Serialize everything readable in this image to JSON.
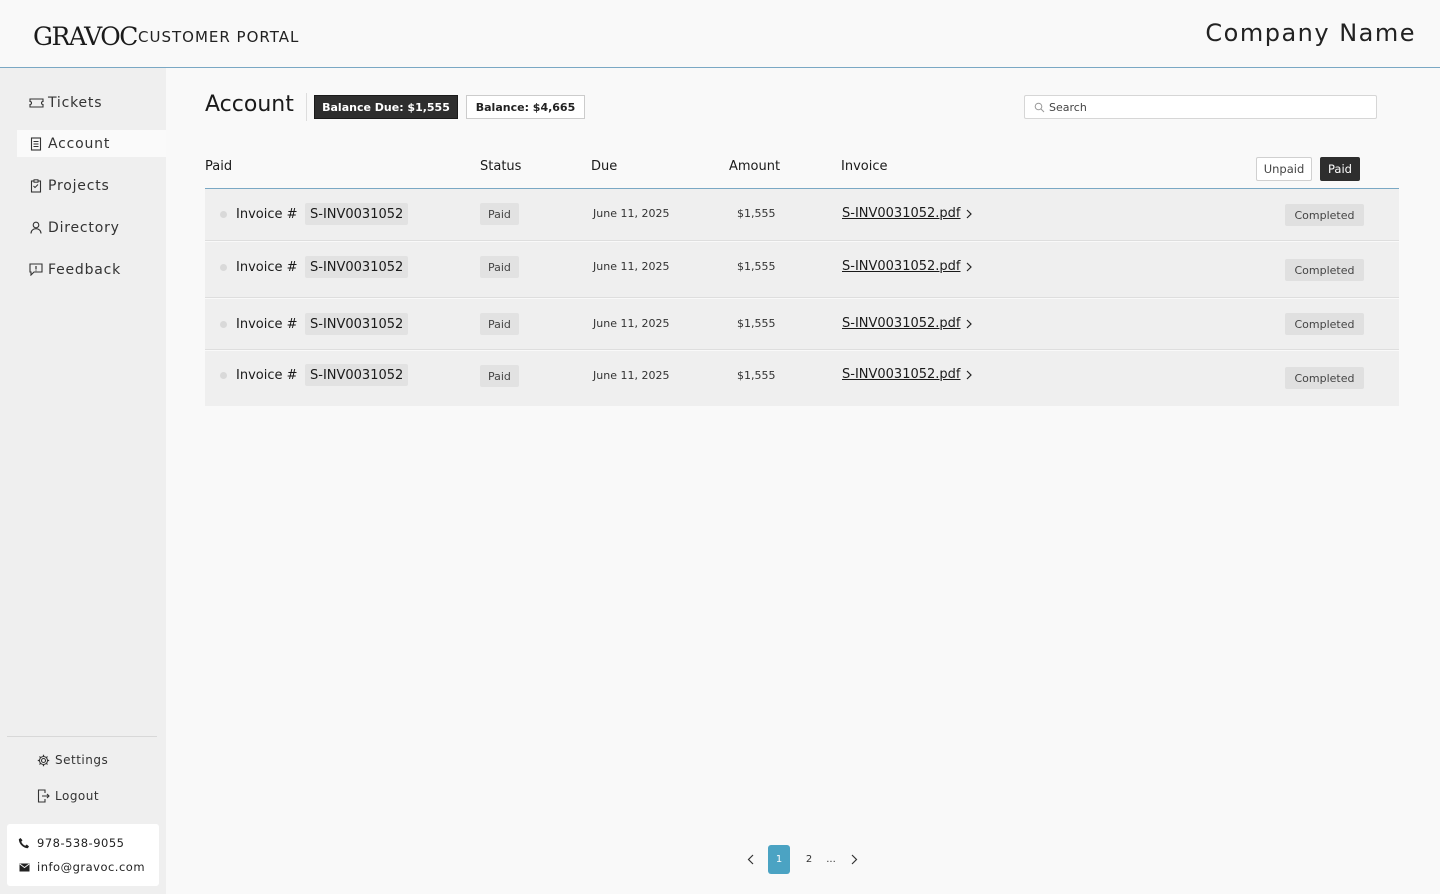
{
  "header": {
    "logo": "GRAVOC",
    "portal_title": "CUSTOMER PORTAL",
    "company_name": "Company Name"
  },
  "sidebar": {
    "items": [
      {
        "label": "Tickets",
        "icon": "ticket-icon",
        "active": false
      },
      {
        "label": "Account",
        "icon": "document-icon",
        "active": true
      },
      {
        "label": "Projects",
        "icon": "clipboard-icon",
        "active": false
      },
      {
        "label": "Directory",
        "icon": "person-icon",
        "active": false
      },
      {
        "label": "Feedback",
        "icon": "feedback-icon",
        "active": false
      }
    ],
    "settings_label": "Settings",
    "logout_label": "Logout",
    "phone": "978-538-9055",
    "email": "info@gravoc.com"
  },
  "main": {
    "title": "Account",
    "balance_due": "Balance Due: $1,555",
    "balance": "Balance: $4,665",
    "search_placeholder": "Search",
    "columns": [
      "Paid",
      "Status",
      "Due",
      "Amount",
      "Invoice"
    ],
    "filters": {
      "unpaid": "Unpaid",
      "paid": "Paid",
      "selected": "Paid"
    },
    "rows": [
      {
        "label": "Invoice #",
        "number": "S-INV0031052",
        "status": "Paid",
        "due": "June 11, 2025",
        "amount": "$1,555",
        "file": "S-INV0031052.pdf",
        "state": "Completed"
      },
      {
        "label": "Invoice #",
        "number": "S-INV0031052",
        "status": "Paid",
        "due": "June 11, 2025",
        "amount": "$1,555",
        "file": "S-INV0031052.pdf",
        "state": "Completed"
      },
      {
        "label": "Invoice #",
        "number": "S-INV0031052",
        "status": "Paid",
        "due": "June 11, 2025",
        "amount": "$1,555",
        "file": "S-INV0031052.pdf",
        "state": "Completed"
      },
      {
        "label": "Invoice #",
        "number": "S-INV0031052",
        "status": "Paid",
        "due": "June 11, 2025",
        "amount": "$1,555",
        "file": "S-INV0031052.pdf",
        "state": "Completed"
      }
    ]
  },
  "pagination": {
    "pages": [
      "1",
      "2"
    ],
    "current": "1",
    "ellipsis": "..."
  },
  "colors": {
    "accent": "#4ba3c3",
    "header_border": "#7aa8c4",
    "dark_button": "#2e2e2e"
  }
}
